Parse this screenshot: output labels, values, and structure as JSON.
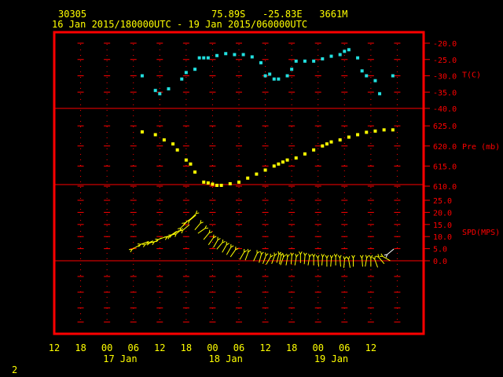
{
  "header": {
    "station": "30305",
    "location": "75.89S   -25.83E   3661M",
    "period": "16 Jan 2015/180000UTC - 19 Jan 2015/060000UTC"
  },
  "footer_label": "2",
  "colors": {
    "frame": "#ff0000",
    "temperature": "#22e0e0",
    "pressure": "#ffff00",
    "wind": "#ffff00",
    "text": "#ffff00",
    "axis_text": "#ff0000"
  },
  "chart_data": [
    {
      "type": "scatter",
      "panel": "temperature",
      "ylabel": "T(C)",
      "ylim": [
        -40,
        -20
      ],
      "ytick_labels": [
        "-20.0",
        "-25.0",
        "-30.0",
        "-35.0",
        "-40.0"
      ],
      "yticks": [
        -20,
        -25,
        -30,
        -35,
        -40
      ],
      "series": [
        {
          "x": [
            20,
            23,
            24,
            26,
            29,
            30,
            32,
            33,
            34,
            35,
            37,
            39,
            41,
            43,
            45,
            47,
            48,
            49,
            50,
            51,
            53,
            54,
            55,
            57,
            59,
            61,
            63,
            65,
            66,
            67,
            69,
            70,
            71,
            73,
            74,
            77
          ],
          "y": [
            -30,
            -34.5,
            -35.5,
            -34,
            -31,
            -29,
            -28,
            -24.5,
            -24.5,
            -24.5,
            -23.8,
            -23.2,
            -23.5,
            -23.5,
            -24.2,
            -26,
            -30,
            -29.5,
            -31,
            -31,
            -30,
            -28,
            -25.5,
            -25.5,
            -25.5,
            -24.8,
            -24,
            -23.5,
            -22.5,
            -22,
            -24.5,
            -28.5,
            -30,
            -31.5,
            -35.5,
            -30
          ]
        }
      ]
    },
    {
      "type": "scatter",
      "panel": "pressure",
      "ylabel": "Pre (mb)",
      "ylim": [
        610,
        627
      ],
      "ytick_labels": [
        "625.0",
        "620.0",
        "615.0",
        "610.0"
      ],
      "yticks": [
        625,
        620,
        615,
        610
      ],
      "series": [
        {
          "x": [
            20,
            23,
            25,
            27,
            28,
            30,
            31,
            32,
            34,
            35,
            36,
            37,
            38,
            40,
            42,
            44,
            46,
            48,
            50,
            51,
            52,
            53,
            55,
            57,
            59,
            61,
            62,
            63,
            65,
            67,
            69,
            71,
            73,
            75,
            77
          ],
          "y": [
            623.5,
            622.8,
            621.5,
            620.5,
            619,
            616.5,
            615.5,
            613.5,
            611,
            610.8,
            610.5,
            610.2,
            610.2,
            610.6,
            611,
            612,
            613,
            614,
            615,
            615.5,
            616,
            616.5,
            617,
            618,
            619,
            620,
            620.5,
            621,
            621.5,
            622.2,
            622.8,
            623.4,
            623.7,
            624,
            624
          ]
        }
      ]
    },
    {
      "type": "wind_barbs",
      "panel": "wind",
      "ylabel": "SPD(MPS)",
      "ylim": [
        0,
        25
      ],
      "ytick_labels": [
        "25.0",
        "20.0",
        "15.0",
        "10.0",
        "5.0",
        "0.0"
      ],
      "yticks": [
        25,
        20,
        15,
        10,
        5,
        0
      ],
      "series": [
        {
          "x": [
            18,
            20,
            21,
            22,
            23,
            24,
            26,
            26.5,
            27,
            28,
            29,
            29.5,
            30,
            31,
            32,
            33,
            34,
            35,
            36,
            37,
            38,
            39,
            40,
            41,
            43,
            44,
            46,
            47,
            48,
            49,
            50,
            51,
            51.5,
            52,
            53,
            54,
            55,
            56,
            57,
            58,
            59,
            60,
            61,
            62,
            63,
            64,
            65,
            66,
            67,
            68,
            70,
            71,
            72,
            73,
            74,
            75,
            76
          ],
          "y": [
            5,
            7,
            7,
            7.5,
            8,
            9,
            10,
            10.5,
            11,
            11.5,
            14,
            13,
            16,
            17,
            19,
            15,
            13,
            11,
            9,
            8,
            7,
            6,
            5,
            4,
            3,
            3,
            2.5,
            2,
            1.5,
            1,
            1.5,
            2,
            1.5,
            1,
            1,
            1.5,
            1,
            2,
            1.5,
            1,
            1,
            0.5,
            1,
            0.5,
            0.5,
            1,
            0.5,
            0,
            0,
            0.5,
            0.5,
            0.5,
            0.5,
            0,
            1,
            1.5,
            3
          ],
          "dir": [
            240,
            250,
            245,
            255,
            240,
            250,
            245,
            235,
            240,
            230,
            225,
            230,
            235,
            230,
            45,
            40,
            55,
            40,
            35,
            30,
            40,
            30,
            30,
            35,
            30,
            20,
            25,
            15,
            20,
            30,
            20,
            15,
            10,
            20,
            10,
            5,
            10,
            0,
            5,
            10,
            0,
            355,
            5,
            0,
            5,
            0,
            355,
            5,
            350,
            0,
            355,
            10,
            0,
            340,
            320,
            300,
            230
          ]
        }
      ]
    }
  ],
  "x_axis": {
    "range_hours": [
      0,
      84
    ],
    "tick_hours": [
      0,
      6,
      12,
      18,
      24,
      30,
      36,
      42,
      48,
      54,
      60,
      66,
      72,
      78,
      84
    ],
    "tick_labels": [
      "12",
      "18",
      "00",
      "06",
      "12",
      "18",
      "00",
      "06",
      "12",
      "18",
      "00",
      "06",
      "12"
    ],
    "label_hours": [
      0,
      6,
      12,
      18,
      24,
      30,
      36,
      42,
      48,
      54,
      60,
      66,
      72
    ],
    "day_labels": [
      "17 Jan",
      "18 Jan",
      "19 Jan"
    ],
    "day_label_hours": [
      15,
      39,
      63
    ]
  },
  "notes_visible": {}
}
